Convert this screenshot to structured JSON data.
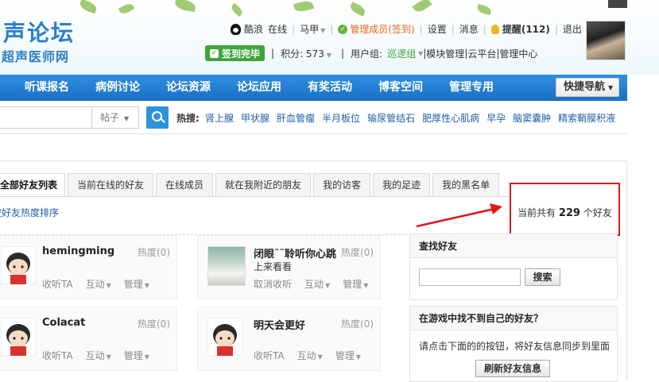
{
  "header": {
    "logo_main": "声论坛",
    "logo_sub": "超声医师网",
    "user": "酷浪",
    "status": "在线",
    "horse": "马甲",
    "member_label": "管理成员(签到)",
    "settings": "设置",
    "messages": "消息",
    "reminders": "提醒(112)",
    "logout": "退出",
    "signin_done": "签到完毕",
    "points": "积分: 573",
    "usergroup_label": "用户组:",
    "usergroup_value": "巡逻组",
    "module_manage": "模块管理",
    "cloud": "云平台",
    "admin_center": "管理中心"
  },
  "nav": {
    "items": [
      "听课报名",
      "病例讨论",
      "论坛资源",
      "论坛应用",
      "有奖活动",
      "博客空间",
      "管理专用"
    ],
    "quick_nav": "快捷导航"
  },
  "search": {
    "type": "帖子",
    "hot_label": "热搜:",
    "hot_items": [
      "肾上腺",
      "甲状腺",
      "肝血管瘤",
      "半月板位",
      "输尿管结石",
      "肥厚性心肌病",
      "早孕",
      "脑窦囊肿",
      "精索鞘膜积液"
    ]
  },
  "tabs": [
    "全部好友列表",
    "当前在线的好友",
    "在线成员",
    "就在我附近的朋友",
    "我的访客",
    "我的足迹",
    "我的黑名单"
  ],
  "sort_link": "按好友热度排序",
  "count": {
    "prefix": "当前共有",
    "number": "229",
    "suffix": "个好友"
  },
  "friends": [
    {
      "name": "hemingming",
      "heat": "热度(0)",
      "sub": "",
      "follow": "收听TA",
      "interact": "互动",
      "manage": "管理"
    },
    {
      "name": "闭眼¨¨聆听你心跳",
      "heat": "热度(0)",
      "sub": "上来看看",
      "follow": "取消收听",
      "interact": "互动",
      "manage": "管理"
    },
    {
      "name": "Colacat",
      "heat": "热度(0)",
      "sub": "",
      "follow": "收听TA",
      "interact": "互动",
      "manage": "管理"
    },
    {
      "name": "明天会更好",
      "heat": "热度(0)",
      "sub": "",
      "follow": "收听TA",
      "interact": "互动",
      "manage": "管理"
    }
  ],
  "find_friend": {
    "title": "查找好友",
    "button": "搜索"
  },
  "game_friend": {
    "title": "在游戏中找不到自己的好友？",
    "text": "请点击下面的的按钮，将好友信息同步到里面",
    "button": "刷新好友信息"
  },
  "colors": {
    "nav_blue": "#1a6fc4",
    "highlight_red": "#e0161b",
    "link_blue": "#1f5fa8",
    "accent_orange": "#e4681e"
  }
}
